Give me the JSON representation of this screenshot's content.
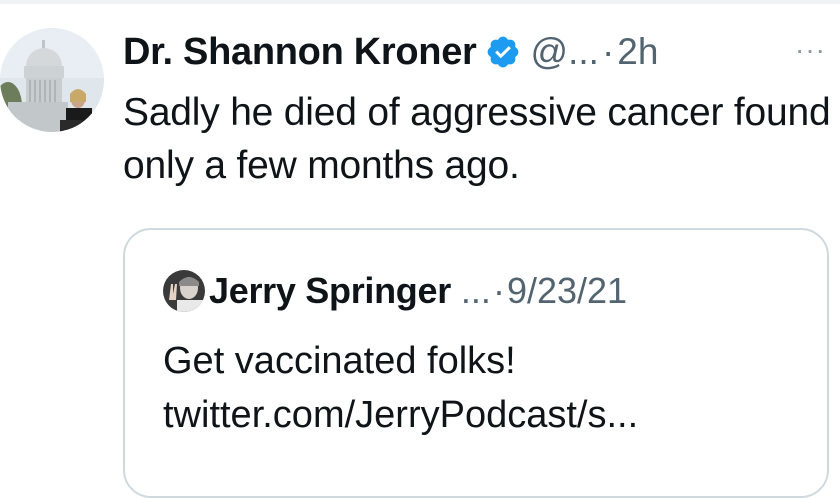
{
  "tweet": {
    "author": {
      "display_name": "Dr. Shannon Kroner",
      "handle": "@...",
      "verified": true
    },
    "separator": "·",
    "time": "2h",
    "more_label": "···",
    "text": "Sadly he died of aggressive cancer found only a few months ago."
  },
  "quoted_tweet": {
    "author": {
      "display_name": "Jerry Springer",
      "handle": "..."
    },
    "separator": "·",
    "date": "9/23/21",
    "text_line1": "Get vaccinated folks!",
    "link": "twitter.com/JerryPodcast/s..."
  },
  "colors": {
    "verified_badge": "#1d9bf0",
    "secondary_text": "#536471",
    "card_border": "#cfd9de"
  },
  "icons": {
    "verified": "verified-badge-icon",
    "more": "more-options-icon"
  }
}
